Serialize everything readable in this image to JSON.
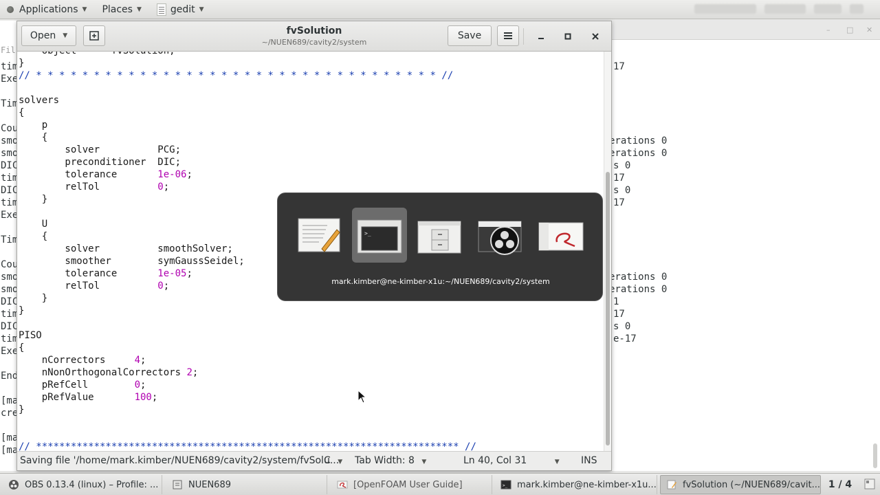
{
  "top_panel": {
    "applications_label": "Applications",
    "places_label": "Places",
    "active_app_label": "gedit"
  },
  "terminal": {
    "left_fragments": [
      "Fil",
      "tim",
      "Exe",
      "",
      "Tim",
      "",
      "Cou",
      "smo",
      "smo",
      "DIC",
      "tim",
      "DIC",
      "tim",
      "Exe",
      "",
      "Tim",
      "",
      "Cou",
      "smo",
      "smo",
      "DIC",
      "tim",
      "DIC",
      "tim",
      "Exe",
      "",
      "End",
      "",
      "[ma",
      "cre",
      "",
      "[ma",
      "[ma"
    ],
    "right_fragments": [
      {
        "text": "17",
        "row": 0
      },
      {
        "text": "erations 0",
        "row": 6
      },
      {
        "text": "erations 0",
        "row": 7
      },
      {
        "text": "s 0",
        "row": 8
      },
      {
        "text": "17",
        "row": 9
      },
      {
        "text": "s 0",
        "row": 10
      },
      {
        "text": "17",
        "row": 11
      },
      {
        "text": "erations 0",
        "row": 17
      },
      {
        "text": "erations 0",
        "row": 18
      },
      {
        "text": "1",
        "row": 19
      },
      {
        "text": "17",
        "row": 20
      },
      {
        "text": "s 0",
        "row": 21
      },
      {
        "text": "e-17",
        "row": 22
      }
    ]
  },
  "gedit": {
    "open_label": "Open",
    "title": "fvSolution",
    "path": "~/NUEN689/cavity2/system",
    "save_label": "Save",
    "code_lines": [
      [
        {
          "t": "    object      fvSolution;"
        }
      ],
      [
        {
          "t": "}"
        }
      ],
      [
        {
          "t": "// * * * * * * * * * * * * * * * * * * * * * * * * * * * * * * * * * * * //",
          "c": "cmt"
        }
      ],
      [
        {
          "t": ""
        }
      ],
      [
        {
          "t": "solvers"
        }
      ],
      [
        {
          "t": "{"
        }
      ],
      [
        {
          "t": "    p"
        }
      ],
      [
        {
          "t": "    {"
        }
      ],
      [
        {
          "t": "        solver          PCG;"
        }
      ],
      [
        {
          "t": "        preconditioner  DIC;"
        }
      ],
      [
        {
          "t": "        tolerance       "
        },
        {
          "t": "1e-06",
          "c": "num"
        },
        {
          "t": ";"
        }
      ],
      [
        {
          "t": "        relTol          "
        },
        {
          "t": "0",
          "c": "num"
        },
        {
          "t": ";"
        }
      ],
      [
        {
          "t": "    }"
        }
      ],
      [
        {
          "t": ""
        }
      ],
      [
        {
          "t": "    U"
        }
      ],
      [
        {
          "t": "    {"
        }
      ],
      [
        {
          "t": "        solver          smoothSolver;"
        }
      ],
      [
        {
          "t": "        smoother        symGaussSeidel;"
        }
      ],
      [
        {
          "t": "        tolerance       "
        },
        {
          "t": "1e-05",
          "c": "num"
        },
        {
          "t": ";"
        }
      ],
      [
        {
          "t": "        relTol          "
        },
        {
          "t": "0",
          "c": "num"
        },
        {
          "t": ";"
        }
      ],
      [
        {
          "t": "    }"
        }
      ],
      [
        {
          "t": "}"
        }
      ],
      [
        {
          "t": ""
        }
      ],
      [
        {
          "t": "PISO"
        }
      ],
      [
        {
          "t": "{"
        }
      ],
      [
        {
          "t": "    nCorrectors     "
        },
        {
          "t": "4",
          "c": "num"
        },
        {
          "t": ";"
        }
      ],
      [
        {
          "t": "    nNonOrthogonalCorrectors "
        },
        {
          "t": "2",
          "c": "num"
        },
        {
          "t": ";"
        }
      ],
      [
        {
          "t": "    pRefCell        "
        },
        {
          "t": "0",
          "c": "num"
        },
        {
          "t": ";"
        }
      ],
      [
        {
          "t": "    pRefValue       "
        },
        {
          "t": "100",
          "c": "num"
        },
        {
          "t": ";"
        }
      ],
      [
        {
          "t": "}"
        }
      ],
      [
        {
          "t": ""
        }
      ],
      [
        {
          "t": ""
        }
      ],
      [
        {
          "t": "// ************************************************************************* //",
          "c": "cmt"
        }
      ]
    ],
    "status": {
      "message": "Saving file '/home/mark.kimber/NUEN689/cavity2/system/fvSolu...",
      "language": "C",
      "tab_width": "Tab Width: 8",
      "position": "Ln 40, Col 31",
      "mode": "INS"
    }
  },
  "switcher": {
    "caption": "mark.kimber@ne-kimber-x1u:~/NUEN689/cavity2/system",
    "items": [
      "text-editor-icon",
      "terminal-icon",
      "file-manager-icon",
      "obs-icon",
      "pdf-viewer-icon"
    ],
    "selected_index": 1
  },
  "taskbar": {
    "tasks": [
      {
        "label": "OBS 0.13.4 (linux) – Profile: ...",
        "icon": "obs-icon",
        "active": false
      },
      {
        "label": "NUEN689",
        "icon": "folder-icon",
        "active": false
      },
      {
        "label": "[OpenFOAM User Guide]",
        "icon": "pdf-icon",
        "active": false
      },
      {
        "label": "mark.kimber@ne-kimber-x1u...",
        "icon": "terminal-icon",
        "active": false
      },
      {
        "label": "fvSolution (~/NUEN689/cavit...",
        "icon": "text-editor-icon",
        "active": true
      }
    ],
    "workspace": "1 / 4"
  },
  "colors": {
    "number_literal": "#b000b0",
    "comment": "#1a3fb0",
    "switcher_bg": "#262626"
  }
}
